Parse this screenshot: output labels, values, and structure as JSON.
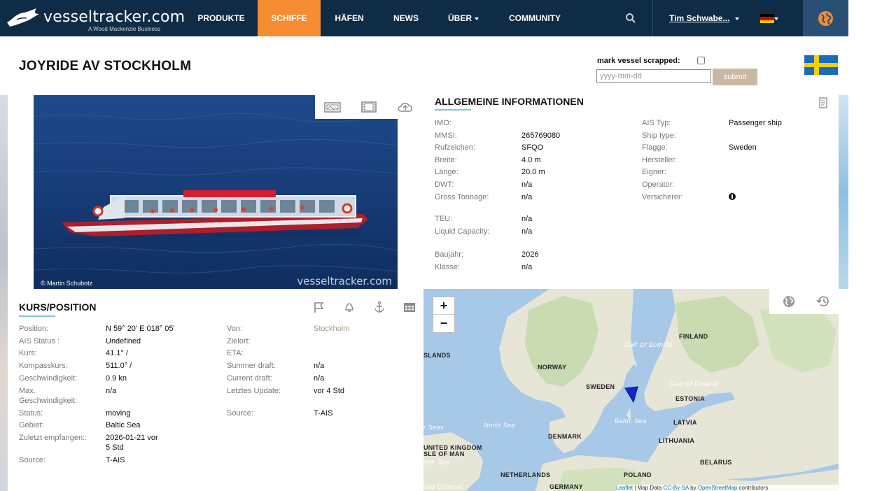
{
  "nav": {
    "logo_name": "vesseltracker.com",
    "logo_sub": "A Wood Mackenzie Business",
    "items": [
      {
        "label": "PRODUKTE"
      },
      {
        "label": "SCHIFFE"
      },
      {
        "label": "HÄFEN"
      },
      {
        "label": "NEWS"
      },
      {
        "label": "ÜBER"
      },
      {
        "label": "COMMUNITY"
      }
    ],
    "user": "Tim Schwabe...",
    "active_color": "#f58c32"
  },
  "vessel": {
    "name": "JOYRIDE AV STOCKHOLM",
    "scrap_label": "mark vessel scrapped:",
    "date_placeholder": "yyyy-mm-dd",
    "submit_label": "submit"
  },
  "photo": {
    "credit": "© Martin Schubotz",
    "watermark": "vesseltracker.com"
  },
  "info": {
    "heading": "ALLGEMEINE INFORMATIONEN",
    "left": [
      {
        "label": "IMO:",
        "value": ""
      },
      {
        "label": "MMSI:",
        "value": "265769080"
      },
      {
        "label": "Rufzeichen:",
        "value": "SFQO"
      },
      {
        "label": "Breite:",
        "value": "4.0 m"
      },
      {
        "label": "Länge:",
        "value": "20.0 m"
      },
      {
        "label": "DWT:",
        "value": "n/a"
      },
      {
        "label": "Gross Tonnage:",
        "value": "n/a"
      },
      {
        "label": "TEU:",
        "value": "n/a"
      },
      {
        "label": "Liquid Capacity:",
        "value": "n/a"
      },
      {
        "label": "Baujahr:",
        "value": "2026"
      },
      {
        "label": "Klasse:",
        "value": "n/a"
      }
    ],
    "right": [
      {
        "label": "AIS Typ:",
        "value": "Passenger ship"
      },
      {
        "label": "Ship type:",
        "value": ""
      },
      {
        "label": "Flagge:",
        "value": "Sweden"
      },
      {
        "label": "Hersteller:",
        "value": ""
      },
      {
        "label": "Eigner:",
        "value": ""
      },
      {
        "label": "Operator:",
        "value": ""
      },
      {
        "label": "Versicherer:",
        "value": ""
      }
    ]
  },
  "kurs": {
    "heading": "KURS/POSITION",
    "left": [
      {
        "label": "Position:",
        "value": "N 59° 20' E 018° 05'"
      },
      {
        "label": "AIS Status :",
        "value": "Undefined"
      },
      {
        "label": "Kurs:",
        "value": "41.1° /"
      },
      {
        "label": "Kompasskurs:",
        "value": "511.0° /"
      },
      {
        "label": "Geschwindigkeit:",
        "value": "0.9 kn"
      },
      {
        "label": "Max. Geschwindigkeit:",
        "value": "n/a"
      },
      {
        "label": "Status:",
        "value": "moving"
      },
      {
        "label": "Gebiet:",
        "value": "Baltic Sea"
      },
      {
        "label": "Zuletzt empfangen::",
        "value": "2026-01-21 vor 5 Std"
      },
      {
        "label": "Source:",
        "value": "T-AIS"
      }
    ],
    "right": [
      {
        "label": "Von:",
        "value": "Stockholm"
      },
      {
        "label": "Zielort:",
        "value": ""
      },
      {
        "label": "ETA:",
        "value": ""
      },
      {
        "label": "Summer draft:",
        "value": "n/a"
      },
      {
        "label": "Current draft:",
        "value": "n/a"
      },
      {
        "label": "Letztes Update:",
        "value": "vor 4 Std"
      },
      {
        "label": "Source:",
        "value": "T-AIS"
      }
    ]
  },
  "map": {
    "zoom_in": "+",
    "zoom_out": "−",
    "labels": {
      "finland": "FINLAND",
      "gulf_bothnia": "Gulf Of Bothnia",
      "islands": "SLANDS",
      "norway": "NORWAY",
      "sweden": "SWEDEN",
      "gulf_finland": "Gulf Of Finland",
      "estonia": "ESTONIA",
      "north_sea": "North Sea",
      "baltic_sea": "Baltic Sea",
      "latvia": "LATVIA",
      "nrs_seas": "r Seas",
      "denmark": "DENMARK",
      "lithuania": "LITHUANIA",
      "uk": "UNITED KINGDOM",
      "isle_man": "SLE OF MAN",
      "irish_sea": "rish Sea",
      "belarus": "BELARUS",
      "netherlands": "NETHERLANDS",
      "poland": "POLAND",
      "germany": "GERMANY",
      "channel": "ctal Channel"
    },
    "attribution": {
      "leaflet": "Leaflet",
      "sep": " | Map Data ",
      "license": "CC-By-SA",
      "by": " by ",
      "osm": "OpenStreetMap",
      "contrib": " contributors"
    }
  }
}
